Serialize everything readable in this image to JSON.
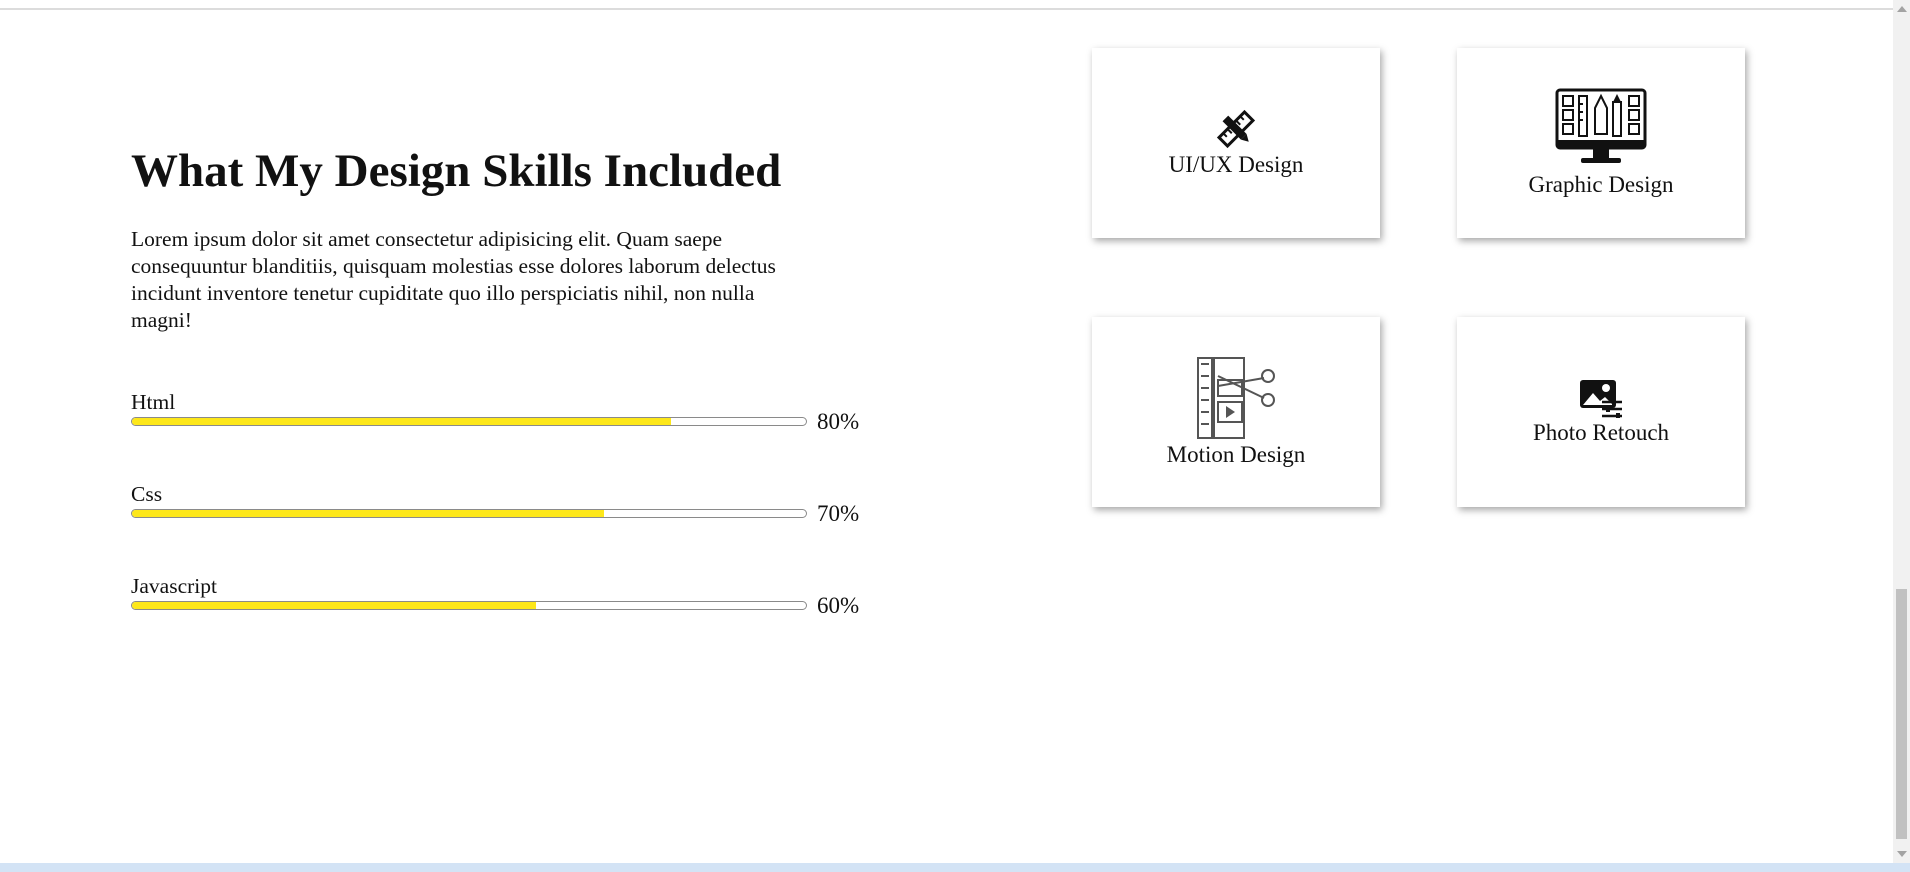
{
  "skills_section": {
    "heading": "What My Design Skills Included",
    "intro": "Lorem ipsum dolor sit amet consectetur adipisicing elit. Quam saepe consequuntur blanditiis, quisquam molestias esse dolores laborum delectus incidunt inventore tenetur cupiditate quo illo perspiciatis nihil, non nulla magni!",
    "skills": [
      {
        "name": "Html",
        "level": 80,
        "label": "80%"
      },
      {
        "name": "Css",
        "level": 70,
        "label": "70%"
      },
      {
        "name": "Javascript",
        "level": 60,
        "label": "60%"
      }
    ],
    "bar_color": "#fde71a"
  },
  "services": [
    {
      "label": "UI/UX Design",
      "icon": "pencil-ruler-icon"
    },
    {
      "label": "Graphic Design",
      "icon": "design-monitor-icon"
    },
    {
      "label": "Motion Design",
      "icon": "film-scissors-icon"
    },
    {
      "label": "Photo Retouch",
      "icon": "photo-adjust-icon"
    }
  ]
}
